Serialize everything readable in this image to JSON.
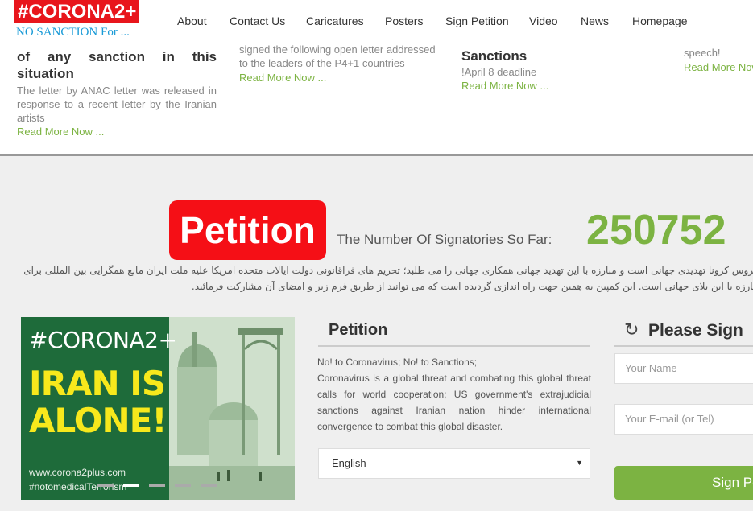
{
  "header": {
    "logo_main": "#CORONA2+",
    "logo_sub": "NO SANCTION For ...",
    "nav": [
      "About",
      "Contact Us",
      "Caricatures",
      "Posters",
      "Sign Petition",
      "Video",
      "News",
      "Homepage"
    ]
  },
  "news": [
    {
      "title": "of any sanction in this situation",
      "text": "The letter by ANAC letter was released in response to a recent letter by the Iranian artists",
      "link": "Read More Now ..."
    },
    {
      "text": "signed the following open letter addressed to the leaders of the P4+1 countries",
      "link": "Read More Now ..."
    },
    {
      "title": "Sanctions",
      "text": "!April 8 deadline",
      "link": "Read More Now ..."
    },
    {
      "text": "speech!",
      "link": "Read More Now ..."
    }
  ],
  "petition_banner": {
    "badge": "Petition",
    "label": "The Number Of Signatories So Far:",
    "count": "250752"
  },
  "farsi_line1": "ویروس کرونا تهدیدی جهانی است و مبارزه با این تهدید جهانی همکاری جهانی را می طلبد؛ تحریم های فراقانونی دولت ایالات متحده امریکا علیه ملت ایران مانع همگرایی بین المللی برای",
  "farsi_line2": "مبارزه با این بلای جهانی است. این کمپین به همین جهت راه اندازی گردیده است که می توانید از طریق فرم زیر و امضای آن مشارکت فرمائید.",
  "poster": {
    "tag": "#CORONA2+",
    "headline_line1": "IRAN IS",
    "headline_line2": "ALONE!",
    "url": "www.corona2plus.com",
    "hashtag": "#notomedicalTerrorism"
  },
  "petition_section": {
    "heading": "Petition",
    "line1": "No! to Coronavirus; No! to Sanctions;",
    "body": "Coronavirus is a global threat and combating this global threat calls for world cooperation; US government's extrajudicial sanctions against Iranian nation hinder international convergence to combat this global disaster.",
    "language": "English"
  },
  "sign_form": {
    "heading": "Please Sign",
    "name_placeholder": "Your Name",
    "email_placeholder": "Your E-mail (or Tel)",
    "button": "Sign Petition"
  }
}
